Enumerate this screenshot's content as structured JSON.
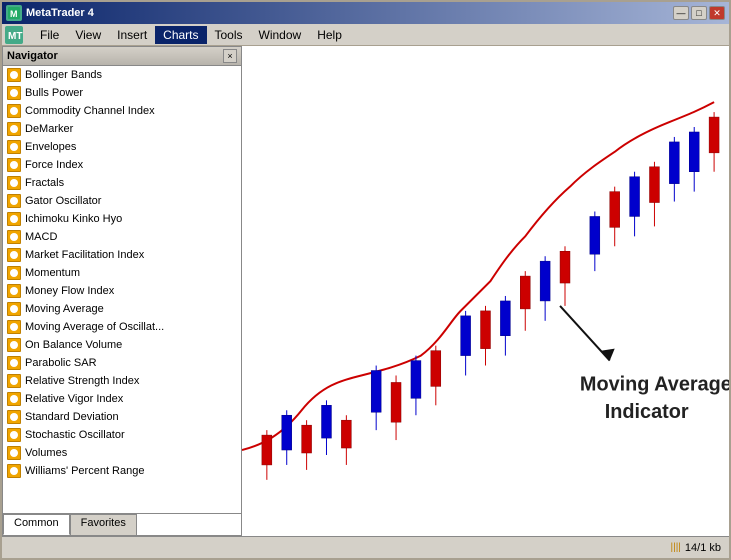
{
  "window": {
    "title": "MetaTrader 4",
    "min_btn": "—",
    "max_btn": "□",
    "close_btn": "✕"
  },
  "menu": {
    "icon_label": "MT",
    "items": [
      "File",
      "View",
      "Insert",
      "Charts",
      "Tools",
      "Window",
      "Help"
    ]
  },
  "navigator": {
    "title": "Navigator",
    "close": "×",
    "items": [
      "Bollinger Bands",
      "Bulls Power",
      "Commodity Channel Index",
      "DeMarker",
      "Envelopes",
      "Force Index",
      "Fractals",
      "Gator Oscillator",
      "Ichimoku Kinko Hyo",
      "MACD",
      "Market Facilitation Index",
      "Momentum",
      "Money Flow Index",
      "Moving Average",
      "Moving Average of Oscillat...",
      "On Balance Volume",
      "Parabolic SAR",
      "Relative Strength Index",
      "Relative Vigor Index",
      "Standard Deviation",
      "Stochastic Oscillator",
      "Volumes",
      "Williams' Percent Range"
    ],
    "tabs": [
      "Common",
      "Favorites"
    ]
  },
  "chart": {
    "label_line1": "Moving Average",
    "label_line2": "Indicator"
  },
  "status": {
    "info": "14/1 kb",
    "icon": "||||"
  }
}
